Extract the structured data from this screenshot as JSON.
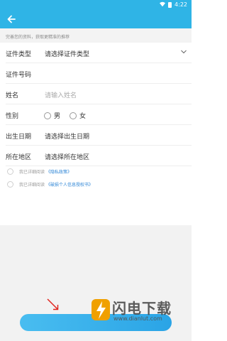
{
  "status_bar": {
    "time": "4:22"
  },
  "notice": "完善您的资料，获取更精准的推荐",
  "form": {
    "id_type": {
      "label": "证件类型",
      "value": "请选择证件类型"
    },
    "id_number": {
      "label": "证件号码"
    },
    "name": {
      "label": "姓名",
      "placeholder": "请输入姓名"
    },
    "gender": {
      "label": "性别",
      "options": [
        "男",
        "女"
      ]
    },
    "birth_date": {
      "label": "出生日期",
      "value": "请选择出生日期"
    },
    "region": {
      "label": "所在地区",
      "value": "请选择所在地区"
    }
  },
  "agreements": [
    {
      "prefix": "我已详细阅读",
      "link": "《隐私政策》"
    },
    {
      "prefix": "我已详细阅读",
      "link": "《破损个人信息授权书》"
    }
  ],
  "watermark": {
    "title": "闪电下载",
    "url": "www.dianlut.com"
  },
  "colors": {
    "primary": "#2fb4e6",
    "link": "#2f86d6",
    "annotation": "#e0201a"
  }
}
